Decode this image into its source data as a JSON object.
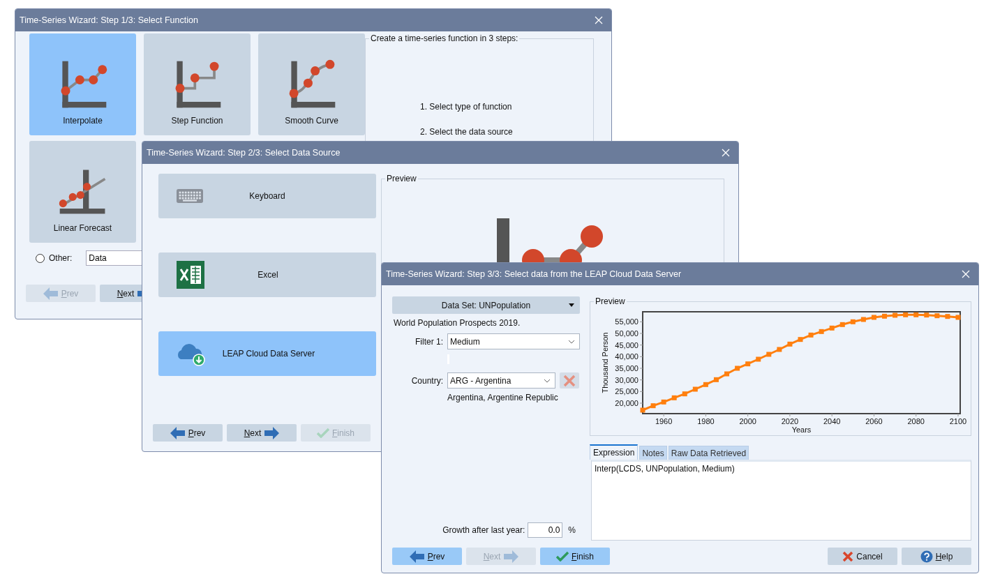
{
  "windows": [
    {
      "kind": "function",
      "title": "Time-Series Wizard: Step 1/3: Select Function",
      "tiles": [
        {
          "label": "Interpolate",
          "kind": "interpolate",
          "selected": true
        },
        {
          "label": "Step Function",
          "kind": "step",
          "selected": false
        },
        {
          "label": "Smooth Curve",
          "kind": "smooth",
          "selected": false
        },
        {
          "label": "Linear Forecast",
          "kind": "linear",
          "selected": false
        }
      ],
      "steps_box": {
        "title": "Create a time-series function in 3 steps:",
        "lines": [
          "1. Select type of function",
          "2. Select the data source"
        ]
      },
      "other": {
        "label": "Other:",
        "checked": false,
        "value": "Data"
      },
      "buttons": [
        {
          "label": "Prev",
          "kind": "prev",
          "disabled": true,
          "highlighted": false,
          "access_key": true
        },
        {
          "label": "Next",
          "kind": "next",
          "disabled": false,
          "highlighted": false,
          "access_key": true
        }
      ]
    },
    {
      "kind": "source",
      "title": "Time-Series Wizard: Step 2/3: Select Data Source",
      "sources": [
        {
          "label": "Keyboard",
          "kind": "keyboard",
          "selected": false
        },
        {
          "label": "Excel",
          "kind": "excel",
          "selected": false
        },
        {
          "label": "LEAP Cloud Data Server",
          "kind": "cloud",
          "selected": true
        }
      ],
      "preview": {
        "title": "Preview"
      },
      "buttons": [
        {
          "label": "Prev",
          "kind": "prev",
          "disabled": false,
          "highlighted": false,
          "access_key": true
        },
        {
          "label": "Next",
          "kind": "next",
          "disabled": false,
          "highlighted": false,
          "access_key": true
        },
        {
          "label": "Finish",
          "kind": "finish",
          "disabled": true,
          "highlighted": false,
          "access_key": true
        }
      ]
    },
    {
      "kind": "cloud",
      "title": "Time-Series Wizard: Step 3/3: Select data from the LEAP Cloud Data Server",
      "dataset": "Data Set: UNPopulation",
      "dataset_description": "World Population Prospects 2019.",
      "filter": {
        "label": "Filter 1:",
        "value": "Medium"
      },
      "country": {
        "label": "Country:",
        "value": "ARG - Argentina",
        "description": "Argentina, Argentine Republic"
      },
      "growth": {
        "label": "Growth after last year:",
        "value": "0.0",
        "unit": "%"
      },
      "preview": {
        "title": "Preview",
        "chart_data": {
          "type": "line",
          "xlabel": "Years",
          "ylabel": "Thousand Person",
          "x": [
            1950,
            1955,
            1960,
            1965,
            1970,
            1975,
            1980,
            1985,
            1990,
            1995,
            2000,
            2005,
            2010,
            2015,
            2020,
            2025,
            2030,
            2035,
            2040,
            2045,
            2050,
            2055,
            2060,
            2065,
            2070,
            2075,
            2080,
            2085,
            2090,
            2095,
            2100
          ],
          "series": [
            {
              "color": "#ff7f0e",
              "marker": "square",
              "values": [
                17000,
                18900,
                20500,
                22300,
                24000,
                26000,
                28000,
                30100,
                32600,
                35000,
                36900,
                38900,
                41000,
                43100,
                45400,
                47400,
                49300,
                50800,
                52300,
                53800,
                55000,
                56000,
                56900,
                57400,
                57800,
                58000,
                58000,
                57900,
                57600,
                57300,
                56900
              ]
            }
          ],
          "xlim": [
            1950,
            2101
          ],
          "ylim": [
            15500,
            59300
          ],
          "xticks": [
            1960,
            1980,
            2000,
            2020,
            2040,
            2060,
            2080,
            2100
          ],
          "yticks": [
            {
              "value": 20000,
              "label": "20,000"
            },
            {
              "value": 25000,
              "label": "25,000"
            },
            {
              "value": 30000,
              "label": "30,000"
            },
            {
              "value": 35000,
              "label": "35,000"
            },
            {
              "value": 40000,
              "label": "40,000"
            },
            {
              "value": 45000,
              "label": "45,000"
            },
            {
              "value": 50000,
              "label": "50,000"
            },
            {
              "value": 55000,
              "label": "55,000"
            }
          ]
        }
      },
      "tabs": [
        {
          "label": "Expression",
          "selected": true
        },
        {
          "label": "Notes",
          "selected": false
        },
        {
          "label": "Raw Data Retrieved",
          "selected": false
        }
      ],
      "expression": "Interp(LCDS, UNPopulation, Medium)",
      "buttons": [
        {
          "label": "Prev",
          "kind": "prev",
          "disabled": false,
          "highlighted": true,
          "access_key": true
        },
        {
          "label": "Next",
          "kind": "next",
          "disabled": true,
          "highlighted": false,
          "access_key": true
        },
        {
          "label": "Finish",
          "kind": "finish",
          "disabled": false,
          "highlighted": true,
          "access_key": true
        }
      ],
      "right_buttons": [
        {
          "label": "Cancel",
          "kind": "cancel",
          "disabled": false,
          "highlighted": false,
          "access_key": false
        },
        {
          "label": "Help",
          "kind": "help",
          "disabled": false,
          "highlighted": false,
          "access_key": true
        }
      ]
    }
  ]
}
